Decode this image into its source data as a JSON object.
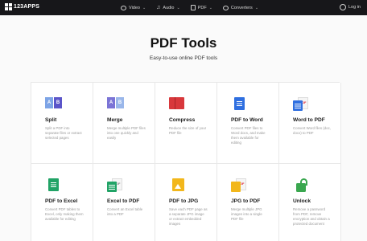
{
  "header": {
    "logo_text": "123APPS",
    "nav": [
      {
        "label": "Video",
        "icon": "video-icon"
      },
      {
        "label": "Audio",
        "icon": "music-note-icon"
      },
      {
        "label": "PDF",
        "icon": "document-icon"
      },
      {
        "label": "Converters",
        "icon": "refresh-icon"
      }
    ],
    "login_label": "Log in"
  },
  "hero": {
    "title": "PDF Tools",
    "subtitle": "Easy-to-use online PDF tools"
  },
  "tools": [
    {
      "title": "Split",
      "desc": "Split a PDF into separate files or extract selected pages",
      "icon": "split-icon"
    },
    {
      "title": "Merge",
      "desc": "Merge multiple PDF files into one quickly and easily",
      "icon": "merge-icon"
    },
    {
      "title": "Compress",
      "desc": "Reduce the size of your PDF file",
      "icon": "compress-icon"
    },
    {
      "title": "PDF to Word",
      "desc": "Convert PDF files to Word docs, and make them available for editing",
      "icon": "word-doc-icon"
    },
    {
      "title": "Word to PDF",
      "desc": "Convert Word files (doc, docx) to PDF",
      "icon": "word-to-pdf-icon"
    },
    {
      "title": "PDF to Excel",
      "desc": "Convert PDF tables to Excel, only making them available for editing",
      "icon": "excel-sheet-icon"
    },
    {
      "title": "Excel to PDF",
      "desc": "Convert an Excel table into a PDF",
      "icon": "excel-to-pdf-icon"
    },
    {
      "title": "PDF to JPG",
      "desc": "Save each PDF page as a separate JPG image or extract embedded images",
      "icon": "image-icon"
    },
    {
      "title": "JPG to PDF",
      "desc": "Merge multiple JPG images into a single PDF file",
      "icon": "jpg-to-pdf-icon"
    },
    {
      "title": "Unlock",
      "desc": "Remove a password from PDF, remove encryption and obtain a protected document",
      "icon": "unlock-icon"
    }
  ],
  "colors": {
    "header_bg": "#17171a",
    "word_blue": "#2f6fe0",
    "excel_green": "#21a366",
    "jpg_yellow": "#f2b71c",
    "compress_red": "#d8383c",
    "unlock_green": "#3aa74f"
  }
}
